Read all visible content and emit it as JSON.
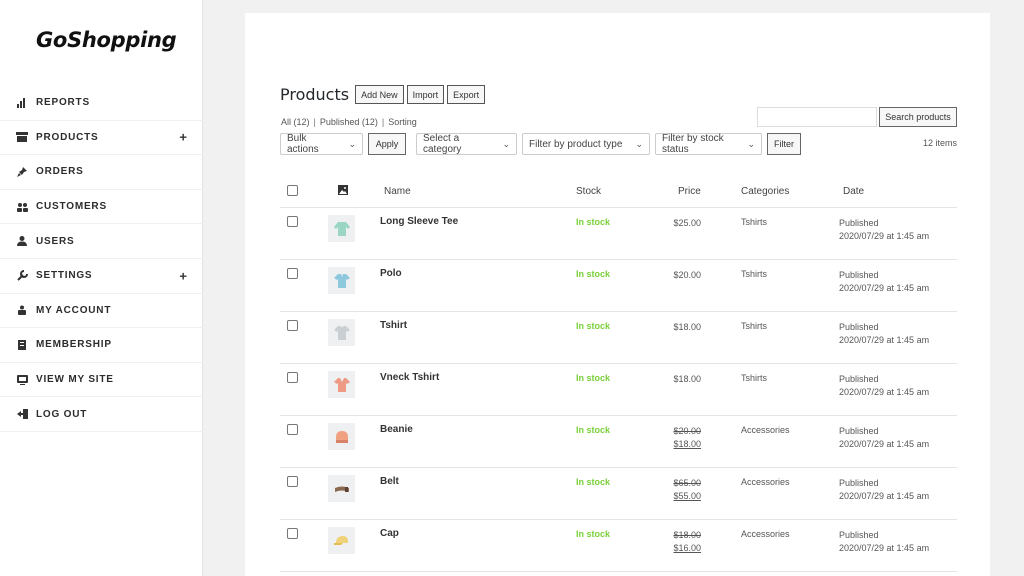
{
  "app": {
    "logo": "GoShopping"
  },
  "sidebar": {
    "items": [
      {
        "label": "REPORTS",
        "icon": "bar-chart-icon",
        "expandable": false
      },
      {
        "label": "PRODUCTS",
        "icon": "store-icon",
        "expandable": true,
        "expand_glyph": "+"
      },
      {
        "label": "ORDERS",
        "icon": "pin-icon",
        "expandable": false
      },
      {
        "label": "CUSTOMERS",
        "icon": "customers-icon",
        "expandable": false
      },
      {
        "label": "USERS",
        "icon": "user-icon",
        "expandable": false
      },
      {
        "label": "SETTINGS",
        "icon": "wrench-icon",
        "expandable": true,
        "expand_glyph": "+"
      },
      {
        "label": "MY ACCOUNT",
        "icon": "account-icon",
        "expandable": false
      },
      {
        "label": "MEMBERSHIP",
        "icon": "membership-icon",
        "expandable": false
      },
      {
        "label": "VIEW MY SITE",
        "icon": "site-icon",
        "expandable": false
      },
      {
        "label": "LOG OUT",
        "icon": "logout-icon",
        "expandable": false
      }
    ]
  },
  "header": {
    "title": "Products",
    "add_new": "Add New",
    "import": "Import",
    "export": "Export"
  },
  "views": {
    "all": "All (12)",
    "published": "Published (12)",
    "sorting": "Sorting",
    "separator": "|"
  },
  "search": {
    "placeholder": "",
    "button": "Search products"
  },
  "filters": {
    "bulk_actions": "Bulk actions",
    "apply": "Apply",
    "category": "Select a category",
    "product_type": "Filter by product type",
    "stock_status": "Filter by stock status",
    "filter": "Filter",
    "items_count": "12 items"
  },
  "table": {
    "headers": {
      "name": "Name",
      "stock": "Stock",
      "price": "Price",
      "categories": "Categories",
      "date": "Date"
    },
    "rows": [
      {
        "name": "Long Sleeve Tee",
        "stock": "In stock",
        "price": "$25.00",
        "old_price": "",
        "category": "Tshirts",
        "status": "Published",
        "date": "2020/07/29 at 1:45 am",
        "thumb_icon": "long-sleeve-tee-icon",
        "color": "#9bd5c4"
      },
      {
        "name": "Polo",
        "stock": "In stock",
        "price": "$20.00",
        "old_price": "",
        "category": "Tshirts",
        "status": "Published",
        "date": "2020/07/29 at 1:45 am",
        "thumb_icon": "polo-shirt-icon",
        "color": "#8ec8dc"
      },
      {
        "name": "Tshirt",
        "stock": "In stock",
        "price": "$18.00",
        "old_price": "",
        "category": "Tshirts",
        "status": "Published",
        "date": "2020/07/29 at 1:45 am",
        "thumb_icon": "tshirt-icon",
        "color": "#c9cfd2"
      },
      {
        "name": "Vneck Tshirt",
        "stock": "In stock",
        "price": "$18.00",
        "old_price": "",
        "category": "Tshirts",
        "status": "Published",
        "date": "2020/07/29 at 1:45 am",
        "thumb_icon": "vneck-tshirt-icon",
        "color": "#ee9a84"
      },
      {
        "name": "Beanie",
        "stock": "In stock",
        "price": "$18.00",
        "old_price": "$20.00",
        "category": "Accessories",
        "status": "Published",
        "date": "2020/07/29 at 1:45 am",
        "thumb_icon": "beanie-icon",
        "color": "#f0a182"
      },
      {
        "name": "Belt",
        "stock": "In stock",
        "price": "$55.00",
        "old_price": "$65.00",
        "category": "Accessories",
        "status": "Published",
        "date": "2020/07/29 at 1:45 am",
        "thumb_icon": "belt-icon",
        "color": "#8a6a50"
      },
      {
        "name": "Cap",
        "stock": "In stock",
        "price": "$16.00",
        "old_price": "$18.00",
        "category": "Accessories",
        "status": "Published",
        "date": "2020/07/29 at 1:45 am",
        "thumb_icon": "cap-icon",
        "color": "#f0d27a"
      }
    ]
  },
  "colors": {
    "in_stock": "#7ad03a",
    "accent": "#23282d"
  }
}
